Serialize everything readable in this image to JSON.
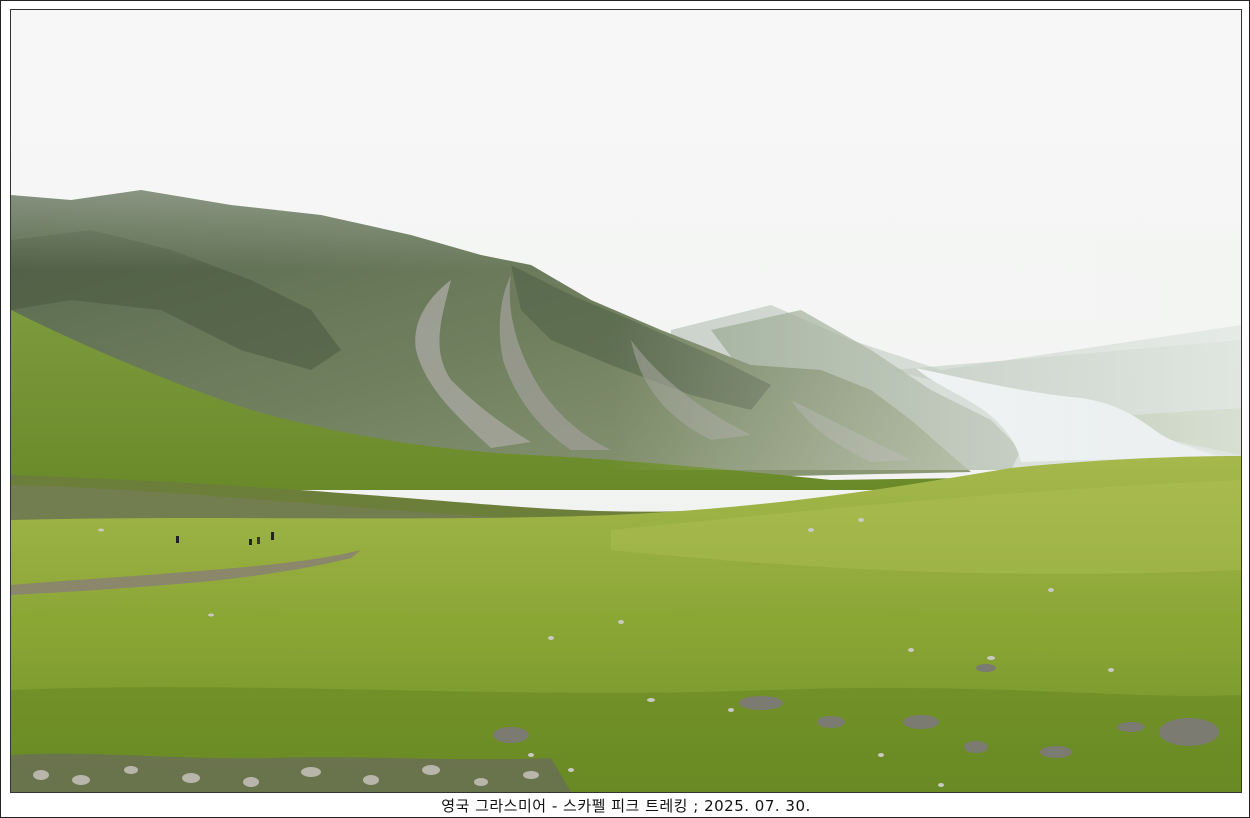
{
  "caption": "영국 그라스미어 - 스카펠 피크 트레킹 ; 2025. 07. 30.",
  "photo": {
    "subject": "misty mountain valley with green grassland, scree slopes and a lake",
    "colors": {
      "sky": "#f4f5f4",
      "mist": "#e8ebe8",
      "mountain_dark": "#4d5b45",
      "mountain_mid": "#6e7f5e",
      "scree": "#9a9a92",
      "grass_light": "#a8b84a",
      "grass_main": "#7f9e2e",
      "grass_dark": "#5f7f22",
      "lake": "#e6ecef",
      "distant_hill": "#a9b7ad"
    }
  }
}
